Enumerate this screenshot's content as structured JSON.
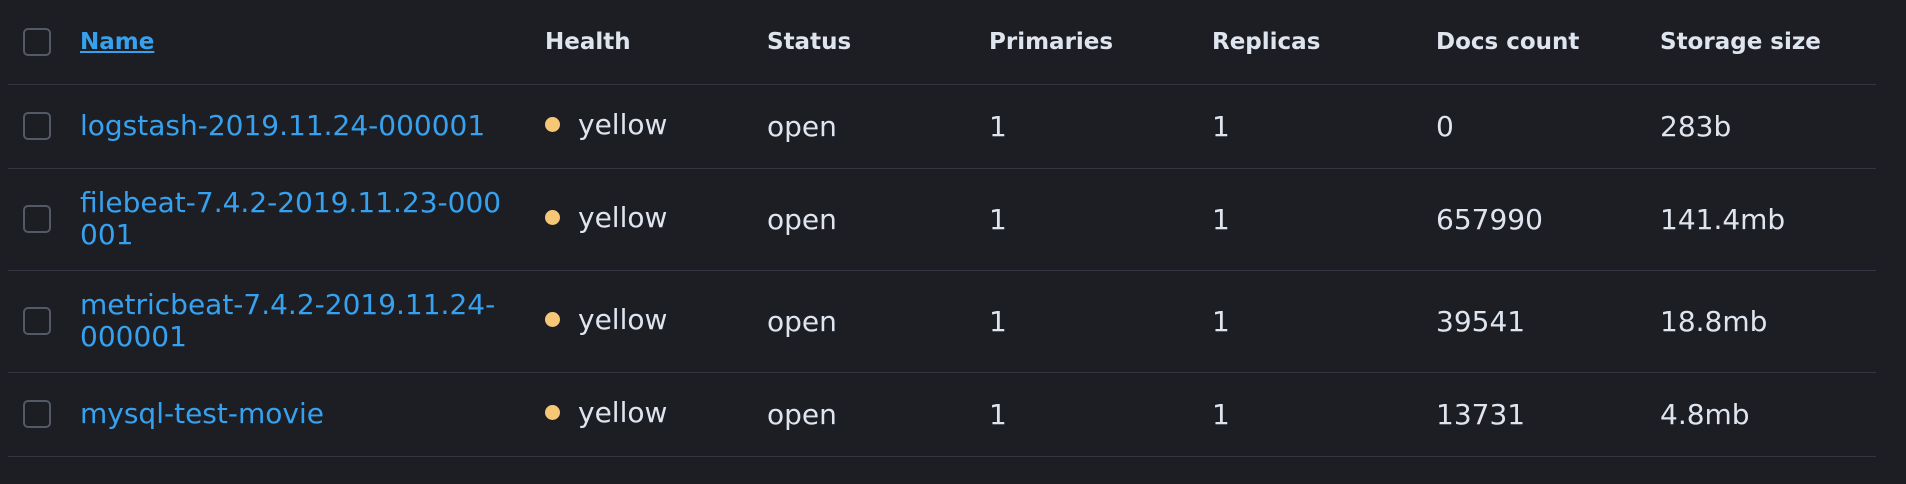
{
  "columns": {
    "name": "Name",
    "health": "Health",
    "status": "Status",
    "primaries": "Primaries",
    "replicas": "Replicas",
    "docs_count": "Docs count",
    "storage_size": "Storage size"
  },
  "colors": {
    "background": "#1d1e24",
    "link": "#36a2ef",
    "health_yellow": "#f5c777",
    "border": "#343741",
    "text": "#dfe5ef"
  },
  "rows": [
    {
      "name": "logstash-2019.11.24-000001",
      "health": "yellow",
      "status": "open",
      "primaries": "1",
      "replicas": "1",
      "docs_count": "0",
      "storage_size": "283b"
    },
    {
      "name": "filebeat-7.4.2-2019.11.23-000001",
      "health": "yellow",
      "status": "open",
      "primaries": "1",
      "replicas": "1",
      "docs_count": "657990",
      "storage_size": "141.4mb"
    },
    {
      "name": "metricbeat-7.4.2-2019.11.24-000001",
      "health": "yellow",
      "status": "open",
      "primaries": "1",
      "replicas": "1",
      "docs_count": "39541",
      "storage_size": "18.8mb"
    },
    {
      "name": "mysql-test-movie",
      "health": "yellow",
      "status": "open",
      "primaries": "1",
      "replicas": "1",
      "docs_count": "13731",
      "storage_size": "4.8mb"
    }
  ]
}
